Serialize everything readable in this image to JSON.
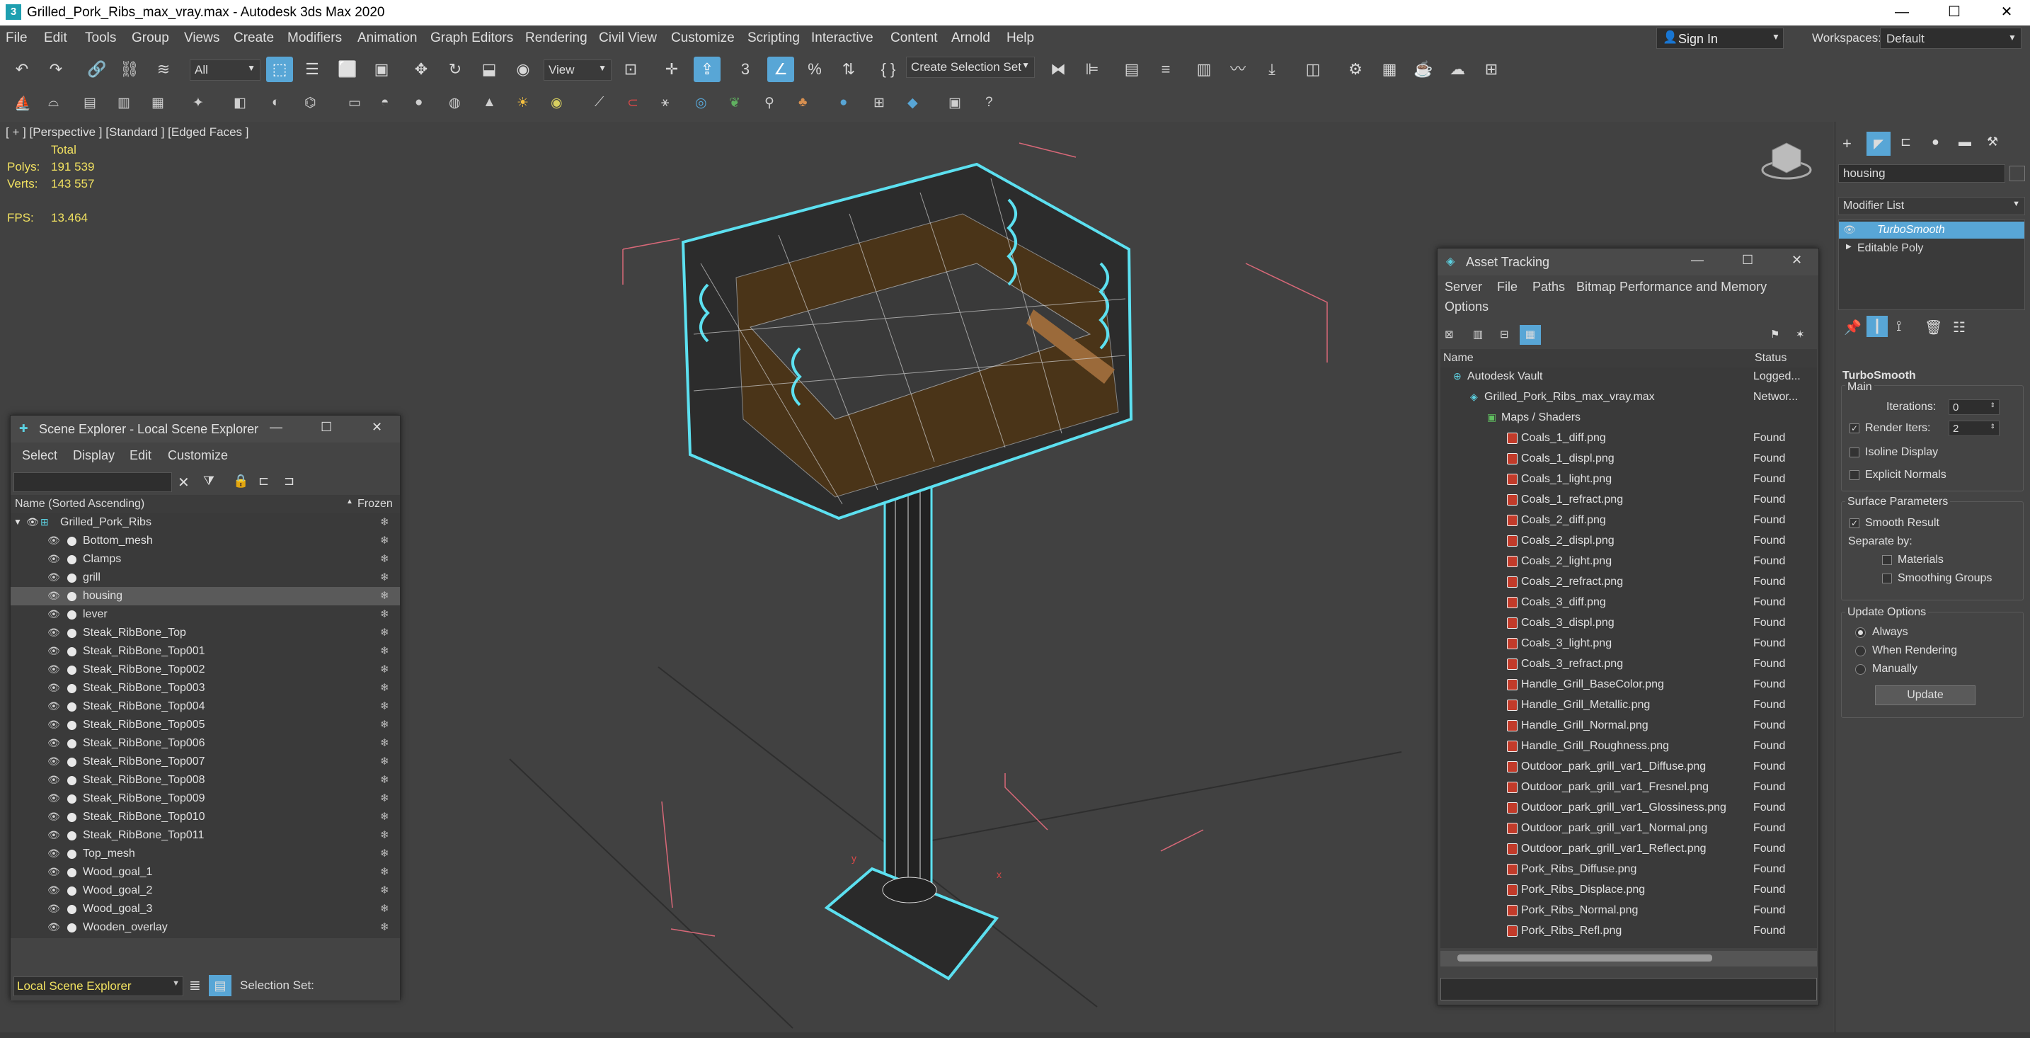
{
  "window": {
    "title": "Grilled_Pork_Ribs_max_vray.max - Autodesk 3ds Max 2020",
    "min": "—",
    "max": "☐",
    "close": "✕"
  },
  "menu": [
    "File",
    "Edit",
    "Tools",
    "Group",
    "Views",
    "Create",
    "Modifiers",
    "Animation",
    "Graph Editors",
    "Rendering",
    "Civil View",
    "Customize",
    "Scripting",
    "Interactive",
    "Content",
    "Arnold",
    "Help"
  ],
  "signin": "Sign In",
  "workspaces_label": "Workspaces:",
  "workspaces_value": "Default",
  "toolbar": {
    "filter": "All",
    "refcoord": "View",
    "selset": "Create Selection Set"
  },
  "viewport": {
    "label": "[ + ] [Perspective ] [Standard ] [Edged Faces ]",
    "total": "Total",
    "polys_label": "Polys:",
    "polys": "191 539",
    "verts_label": "Verts:",
    "verts": "143 557",
    "fps_label": "FPS:",
    "fps": "13.464"
  },
  "scene_explorer": {
    "title": "Scene Explorer - Local Scene Explorer",
    "menu": [
      "Select",
      "Display",
      "Edit",
      "Customize"
    ],
    "col_name": "Name (Sorted Ascending)",
    "col_frozen": "Frozen",
    "root": "Grilled_Pork_Ribs",
    "items": [
      "Bottom_mesh",
      "Clamps",
      "grill",
      "housing",
      "lever",
      "Steak_RibBone_Top",
      "Steak_RibBone_Top001",
      "Steak_RibBone_Top002",
      "Steak_RibBone_Top003",
      "Steak_RibBone_Top004",
      "Steak_RibBone_Top005",
      "Steak_RibBone_Top006",
      "Steak_RibBone_Top007",
      "Steak_RibBone_Top008",
      "Steak_RibBone_Top009",
      "Steak_RibBone_Top010",
      "Steak_RibBone_Top011",
      "Top_mesh",
      "Wood_goal_1",
      "Wood_goal_2",
      "Wood_goal_3",
      "Wooden_overlay"
    ],
    "selected": "housing",
    "footer_dropdown": "Local Scene Explorer",
    "selection_set": "Selection Set:"
  },
  "asset_tracking": {
    "title": "Asset Tracking",
    "menu": [
      "Server",
      "File",
      "Paths",
      "Bitmap Performance and Memory",
      "Options"
    ],
    "col_name": "Name",
    "col_status": "Status",
    "vault": "Autodesk Vault",
    "vault_status": "Logged...",
    "file": "Grilled_Pork_Ribs_max_vray.max",
    "file_status": "Networ...",
    "maps": "Maps / Shaders",
    "items": [
      "Coals_1_diff.png",
      "Coals_1_displ.png",
      "Coals_1_light.png",
      "Coals_1_refract.png",
      "Coals_2_diff.png",
      "Coals_2_displ.png",
      "Coals_2_light.png",
      "Coals_2_refract.png",
      "Coals_3_diff.png",
      "Coals_3_displ.png",
      "Coals_3_light.png",
      "Coals_3_refract.png",
      "Handle_Grill_BaseColor.png",
      "Handle_Grill_Metallic.png",
      "Handle_Grill_Normal.png",
      "Handle_Grill_Roughness.png",
      "Outdoor_park_grill_var1_Diffuse.png",
      "Outdoor_park_grill_var1_Fresnel.png",
      "Outdoor_park_grill_var1_Glossiness.png",
      "Outdoor_park_grill_var1_Normal.png",
      "Outdoor_park_grill_var1_Reflect.png",
      "Pork_Ribs_Diffuse.png",
      "Pork_Ribs_Displace.png",
      "Pork_Ribs_Normal.png",
      "Pork_Ribs_Refl.png"
    ],
    "status": "Found"
  },
  "command_panel": {
    "object_name": "housing",
    "modifier_list": "Modifier List",
    "stack": [
      "TurboSmooth",
      "Editable Poly"
    ],
    "rollout": "TurboSmooth",
    "main": "Main",
    "iterations_label": "Iterations:",
    "iterations": "0",
    "render_iters_label": "Render Iters:",
    "render_iters": "2",
    "isoline": "Isoline Display",
    "explicit": "Explicit Normals",
    "surface": "Surface Parameters",
    "smooth_result": "Smooth Result",
    "separate_by": "Separate by:",
    "materials": "Materials",
    "smoothing_groups": "Smoothing Groups",
    "update_options": "Update Options",
    "always": "Always",
    "when_rendering": "When Rendering",
    "manually": "Manually",
    "update": "Update"
  },
  "colors": {
    "accent": "#58a6d6",
    "selection": "#5ce0f0",
    "found_icon": "#c23b2a",
    "stat": "#f0e060"
  }
}
